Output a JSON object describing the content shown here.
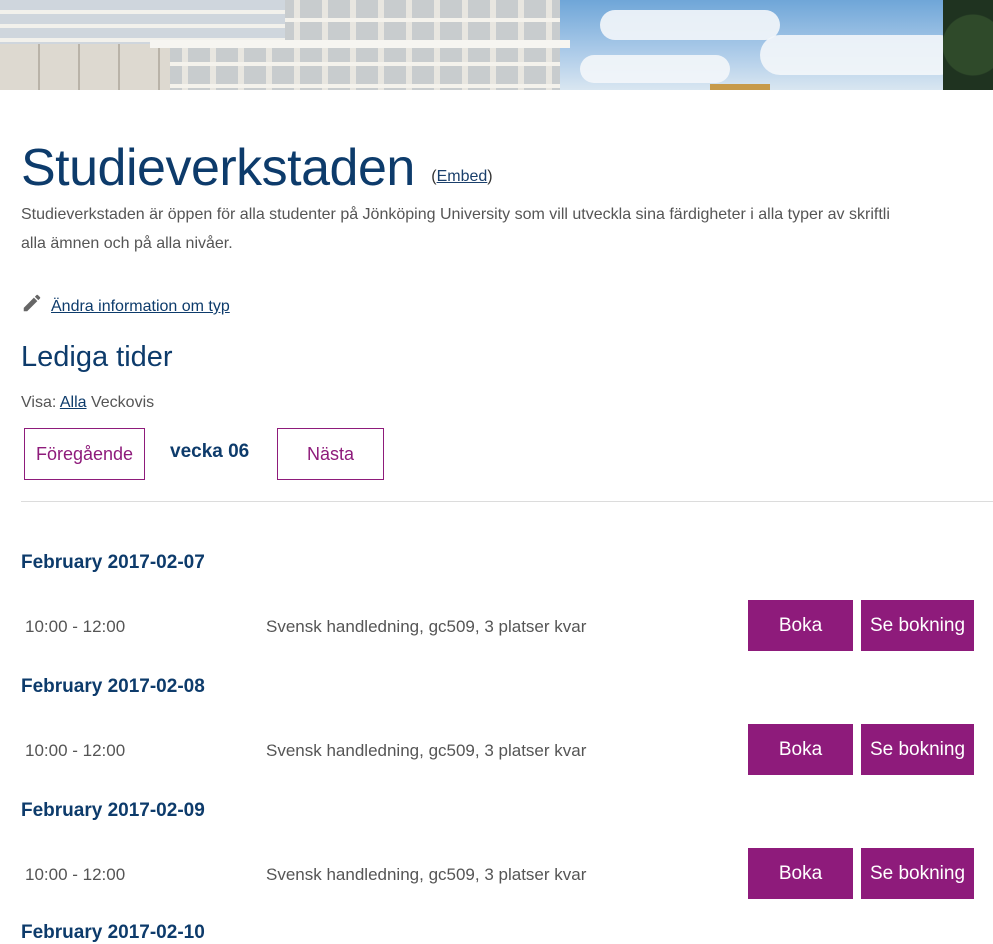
{
  "hero": {
    "image_alt": "campus-building-photo"
  },
  "header": {
    "title": "Studieverkstaden",
    "embed_open": "(",
    "embed_label": "Embed",
    "embed_close": ")",
    "description_line1": "Studieverkstaden är öppen för alla studenter på Jönköping University som vill utveckla sina färdigheter i alla typer av skriftli",
    "description_line2": "alla ämnen och på alla nivåer."
  },
  "edit": {
    "label": "Ändra information om typ",
    "icon": "pencil-icon"
  },
  "section": {
    "title": "Lediga tider",
    "visa_label": "Visa:",
    "visa_all": "Alla",
    "visa_weekly": "Veckovis"
  },
  "week_nav": {
    "prev_label": "Föregående",
    "week_label": "vecka 06",
    "next_label": "Nästa"
  },
  "days": [
    {
      "date": "February 2017-02-07",
      "time": "10:00 - 12:00",
      "info": "Svensk handledning, gc509, 3 platser kvar",
      "book_label": "Boka",
      "view_label": "Se bokning"
    },
    {
      "date": "February 2017-02-08",
      "time": "10:00 - 12:00",
      "info": "Svensk handledning, gc509, 3 platser kvar",
      "book_label": "Boka",
      "view_label": "Se bokning"
    },
    {
      "date": "February 2017-02-09",
      "time": "10:00 - 12:00",
      "info": "Svensk handledning, gc509, 3 platser kvar",
      "book_label": "Boka",
      "view_label": "Se bokning"
    },
    {
      "date": "February 2017-02-10"
    }
  ],
  "colors": {
    "primary": "#0d3b6b",
    "accent": "#8e1b7b",
    "text": "#555555"
  }
}
